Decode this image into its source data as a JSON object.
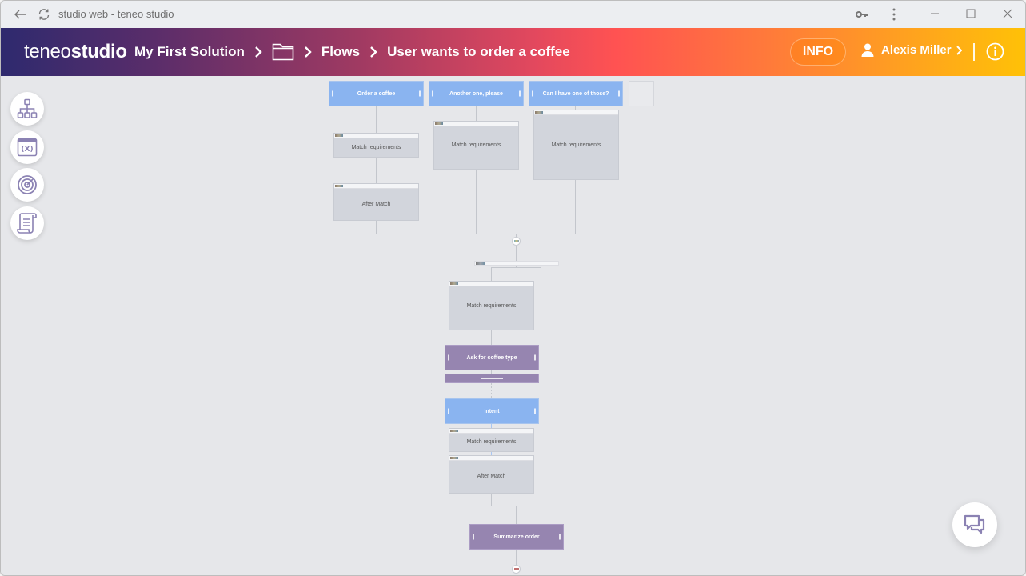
{
  "browser": {
    "title": "studio web - teneo studio",
    "icons": {
      "back": "arrow-left-icon",
      "reload": "reload-icon",
      "key": "key-icon",
      "more": "more-vertical-icon",
      "minimize": "minimize-icon",
      "maximize": "maximize-icon",
      "close": "close-icon"
    }
  },
  "header": {
    "logo_light": "teneo",
    "logo_bold": "studio",
    "breadcrumb": [
      {
        "label": "My First Solution"
      },
      {
        "icon": "folder-icon"
      },
      {
        "label": "Flows"
      },
      {
        "label": "User wants to order a coffee"
      }
    ],
    "info_button": "INFO",
    "user_name": "Alexis Miller",
    "colors": {
      "gradient_start": "#2e2a6e",
      "gradient_mid": "#ff5252",
      "gradient_end": "#ffc107"
    }
  },
  "sidebar": {
    "buttons": [
      {
        "name": "flow-structure",
        "icon": "hierarchy-icon"
      },
      {
        "name": "variables",
        "icon": "variables-icon"
      },
      {
        "name": "targets",
        "icon": "target-icon"
      },
      {
        "name": "scripts",
        "icon": "script-scroll-icon"
      }
    ]
  },
  "flow": {
    "triggers": [
      {
        "label": "Order a coffee"
      },
      {
        "label": "Another one, please"
      },
      {
        "label": "Can I have one of those?"
      }
    ],
    "trigger_matches": [
      {
        "label": "Match requirements"
      },
      {
        "label": "Match requirements"
      },
      {
        "label": "Match requirements"
      }
    ],
    "trigger_after_match": {
      "label": "After Match"
    },
    "start_match": {
      "label": "Match requirements"
    },
    "output_ask": {
      "label": "Ask for coffee type"
    },
    "intent": {
      "label": "Intent"
    },
    "intent_match": {
      "label": "Match requirements"
    },
    "intent_after_match": {
      "label": "After Match"
    },
    "output_summarize": {
      "label": "Summarize order"
    },
    "colors": {
      "trigger": "#8ab4f0",
      "output": "#9685b0",
      "box": "#d2d5dc",
      "canvas": "#e6e7ea"
    }
  },
  "chat": {
    "icon": "chat-bubbles-icon"
  }
}
